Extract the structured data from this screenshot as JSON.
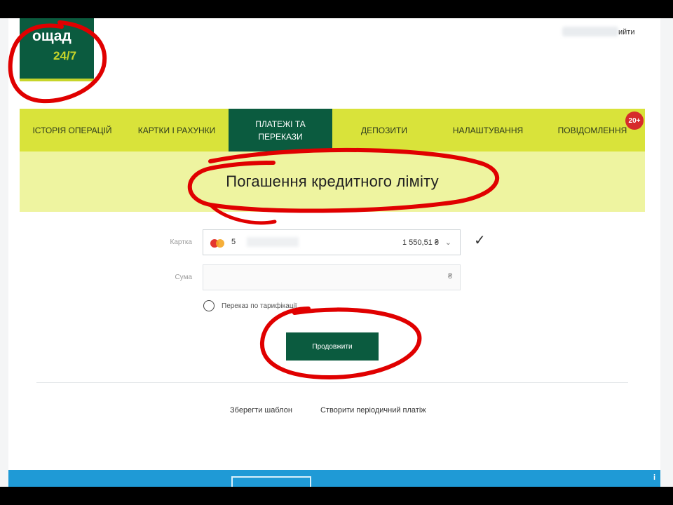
{
  "logo": {
    "name": "ощад",
    "sub": "24/7"
  },
  "header": {
    "logout": "ийти"
  },
  "nav": {
    "items": [
      {
        "label": "ІСТОРІЯ ОПЕРАЦІЙ"
      },
      {
        "label": "КАРТКИ І РАХУНКИ"
      },
      {
        "label": "ПЛАТЕЖІ ТА ПЕРЕКАЗИ",
        "active": true
      },
      {
        "label": "ДЕПОЗИТИ"
      },
      {
        "label": "НАЛАШТУВАННЯ"
      },
      {
        "label": "ПОВІДОМЛЕННЯ"
      }
    ],
    "badge": "20+"
  },
  "page_title": "Погашення кредитного ліміту",
  "form": {
    "card_label": "Картка",
    "card_number_prefix": "5",
    "card_balance": "1 550,51 ₴",
    "amount_label": "Сума",
    "amount_value": "",
    "currency": "₴",
    "radio_label": "Переказ по тарифікації"
  },
  "continue_label": "Продовжити",
  "footer": {
    "save_template": "Зберегти шаблон",
    "create_periodic": "Створити періодичний платіж"
  },
  "colors": {
    "brand_green": "#0b5b3f",
    "nav_yellow": "#d9e33a",
    "title_band": "#eef4a0",
    "annotation_red": "#e00000",
    "bottom_bar": "#1f9ad6"
  }
}
